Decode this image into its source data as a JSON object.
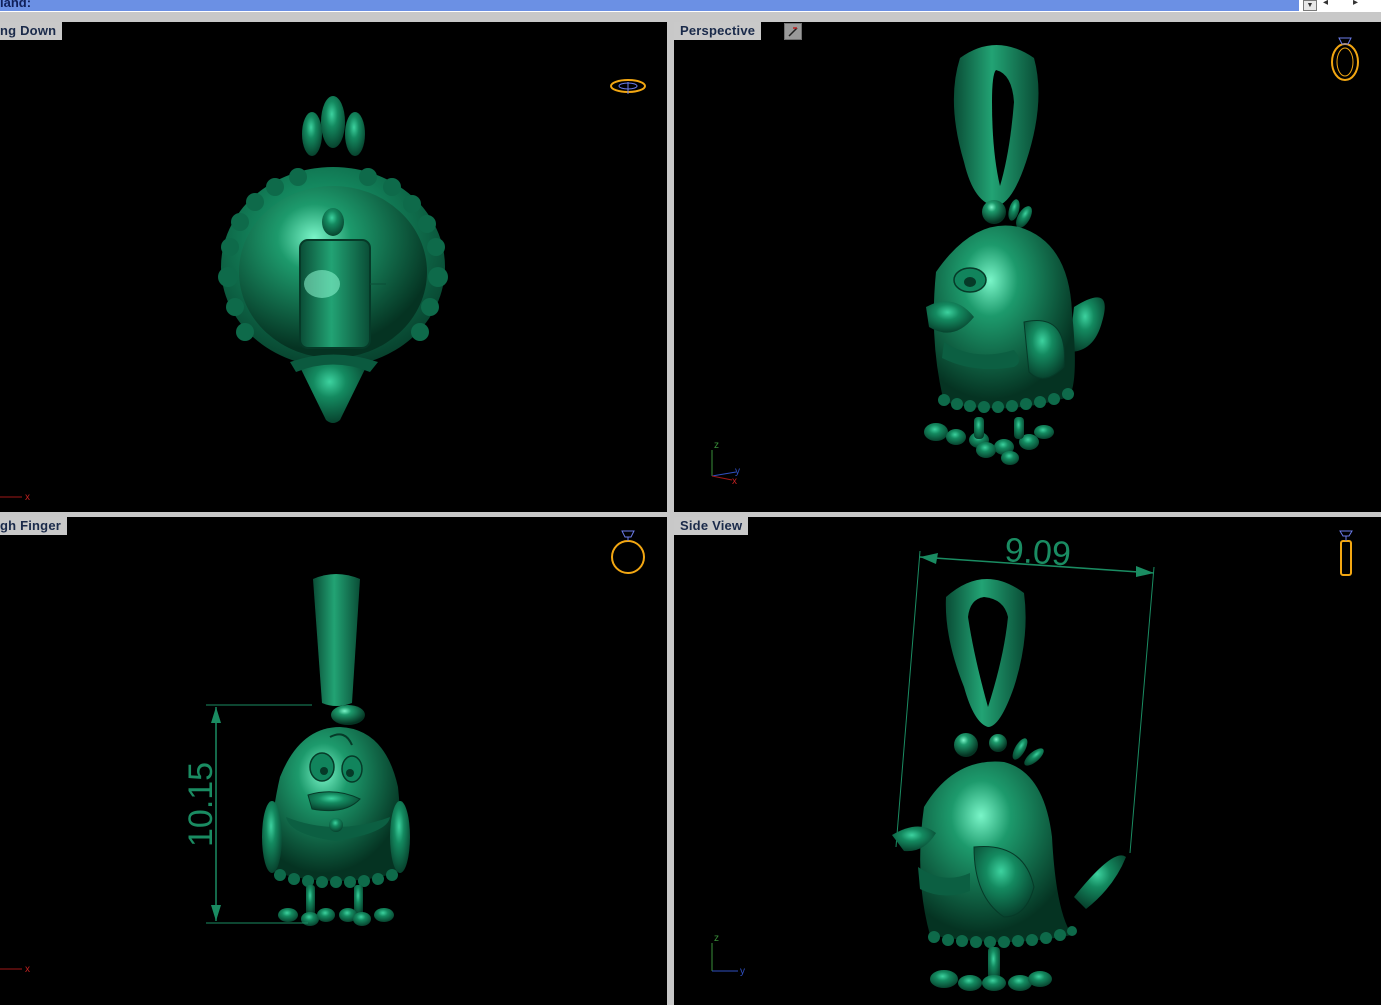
{
  "command_bar": {
    "label": "iand:"
  },
  "viewports": {
    "top_left": {
      "title": "ng Down"
    },
    "top_right": {
      "title": "Perspective"
    },
    "bottom_left": {
      "title": "gh Finger"
    },
    "bottom_right": {
      "title": "Side View"
    }
  },
  "axes": {
    "x": "x",
    "y": "y",
    "z": "z"
  },
  "dimensions": {
    "vertical": "10.15",
    "horizontal": "9.09"
  },
  "icons": {
    "view_ring": "ring-view-icon",
    "perspective_toggle": "perspective-icon"
  },
  "colors": {
    "model": "#0f6b4c",
    "model_highlight": "#4fe0b0",
    "viewport_bg": "#000000",
    "dimension": "#1a8c62",
    "ring_icon": "#f3a712",
    "title_tab": "#c9c9c9"
  }
}
